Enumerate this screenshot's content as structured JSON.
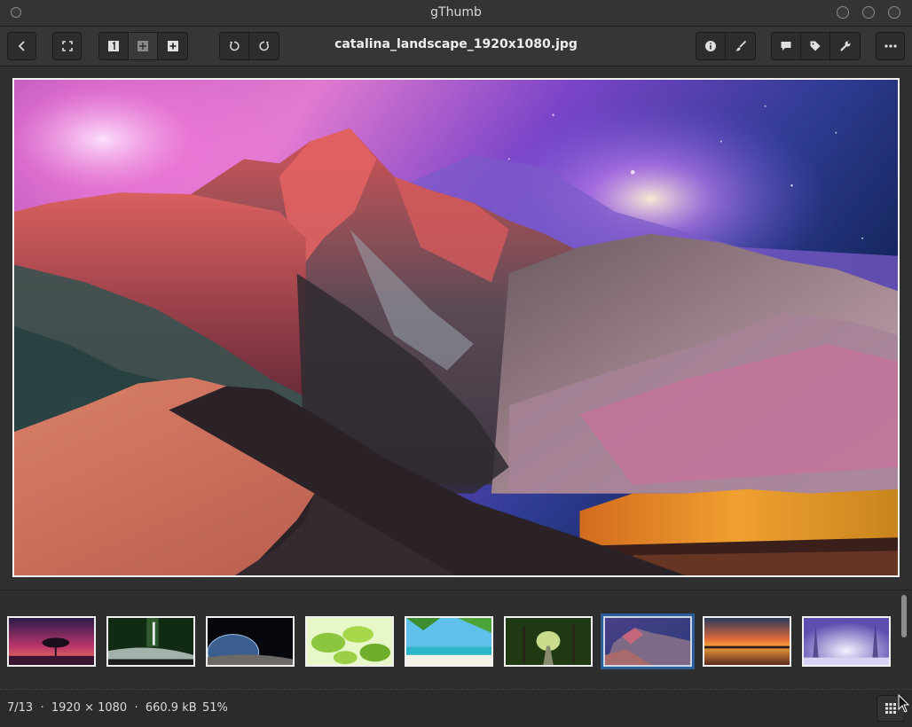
{
  "window": {
    "title": "gThumb"
  },
  "header": {
    "back_icon": "chevron-left-icon",
    "fullscreen_icon": "fullscreen-icon",
    "zoom_group": [
      "actual-size-icon",
      "fit-icon",
      "zoom-in-icon"
    ],
    "rotate_group": [
      "rotate-left-icon",
      "rotate-right-icon"
    ],
    "filename": "catalina_landscape_1920x1080.jpg",
    "tools_group": [
      "info-icon",
      "brush-icon"
    ],
    "meta_group": [
      "comment-icon",
      "tag-icon",
      "wrench-icon"
    ],
    "menu_icon": "more-icon"
  },
  "thumbnails": [
    {
      "name": "tree-sunset",
      "colors": [
        "#2a1b4a",
        "#d4496b"
      ]
    },
    {
      "name": "forest-waterfall",
      "colors": [
        "#0f2612",
        "#5f8a57"
      ]
    },
    {
      "name": "earth-space",
      "colors": [
        "#05070d",
        "#3a5f8f"
      ]
    },
    {
      "name": "green-leaves",
      "colors": [
        "#9fcf4a",
        "#e8f7c8"
      ]
    },
    {
      "name": "beach-palm",
      "colors": [
        "#4db4e0",
        "#f2f7ff"
      ]
    },
    {
      "name": "tree-tunnel",
      "colors": [
        "#1f3a12",
        "#a9c46b"
      ]
    },
    {
      "name": "catalina-landscape",
      "colors": [
        "#3f3a72",
        "#d46d7d"
      ],
      "selected": true
    },
    {
      "name": "orange-sunset",
      "colors": [
        "#20304a",
        "#f07a2a"
      ]
    },
    {
      "name": "purple-snow-forest",
      "colors": [
        "#5d4fb0",
        "#e8e2ff"
      ]
    }
  ],
  "status": {
    "info": "7/13  ·  1920 × 1080  ·  660.9 kB",
    "zoom": "51%"
  },
  "colors": {
    "accent": "#2a5d9a",
    "background": "#2b2b2b"
  }
}
